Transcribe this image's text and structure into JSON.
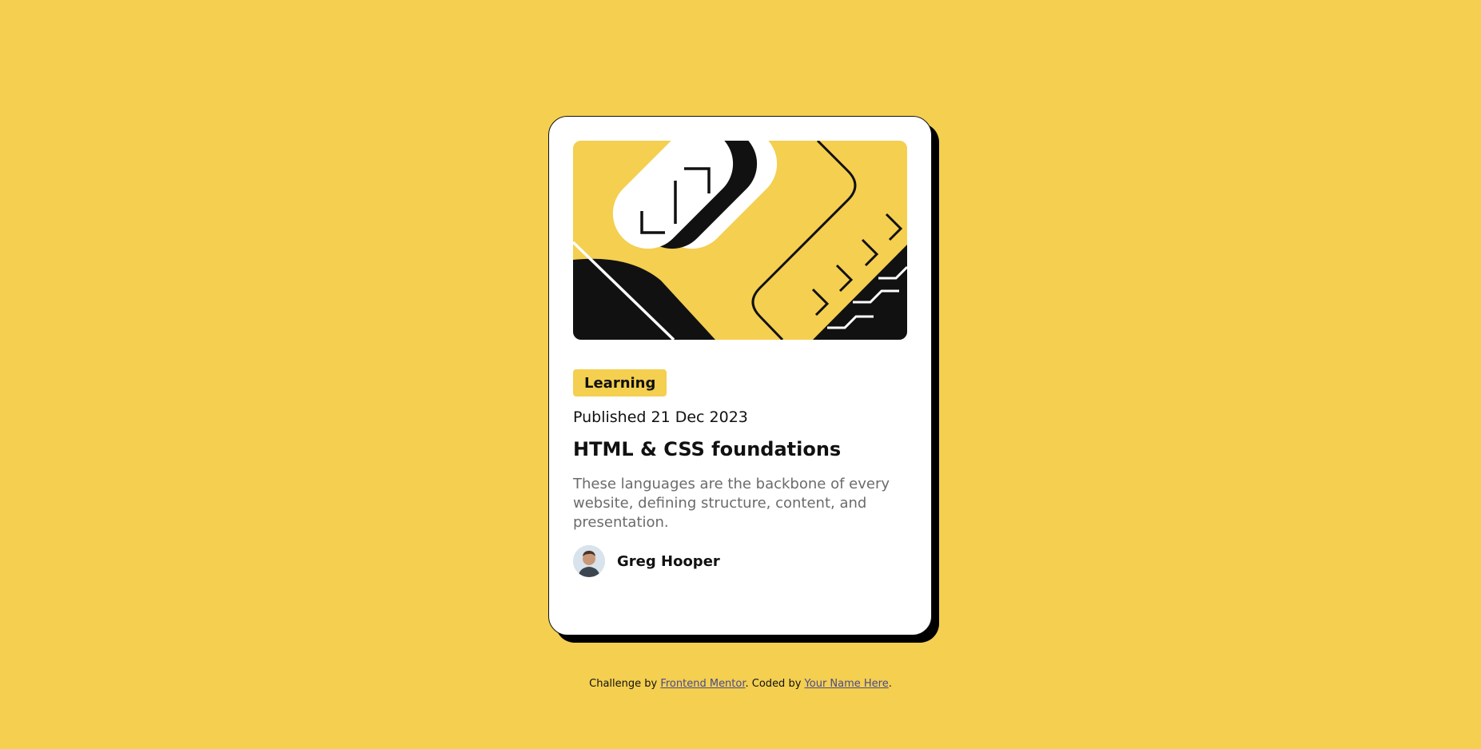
{
  "colors": {
    "background": "#F4CF50",
    "card": "#FFFFFF",
    "text": "#111111",
    "muted_text": "#6B6B6B",
    "shadow": "#000000",
    "link": "#4A4A8A"
  },
  "card": {
    "illustration_icon": "abstract-learning-illustration",
    "tag": "Learning",
    "published": "Published 21 Dec 2023",
    "title": "HTML & CSS foundations",
    "description": "These languages are the backbone of every website, defining structure, content, and presentation.",
    "author": {
      "avatar_icon": "author-avatar",
      "name": "Greg Hooper"
    }
  },
  "attribution": {
    "prefix": "Challenge by ",
    "link1": "Frontend Mentor",
    "middle": ". Coded by ",
    "link2": "Your Name Here",
    "suffix": "."
  }
}
